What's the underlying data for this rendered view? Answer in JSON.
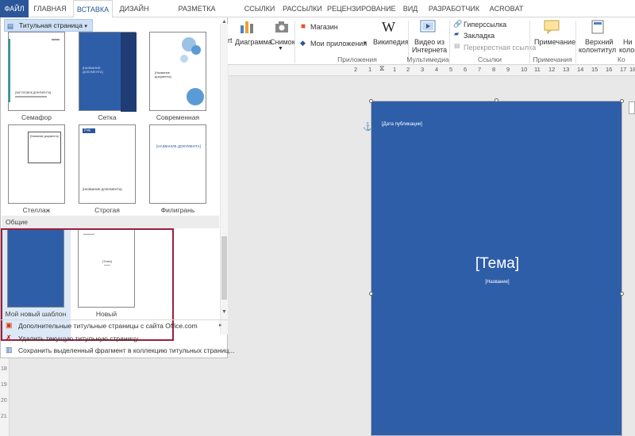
{
  "tabs": [
    "ФАЙЛ",
    "ГЛАВНАЯ",
    "ВСТАВКА",
    "ДИЗАЙН",
    "РАЗМЕТКА СТРАНИЦЫ",
    "ССЫЛКИ",
    "РАССЫЛКИ",
    "РЕЦЕНЗИРОВАНИЕ",
    "ВИД",
    "РАЗРАБОТЧИК",
    "ACROBAT"
  ],
  "ribbon": {
    "partial_left": "rt",
    "diagram": "Диаграмма",
    "snapshot": "Снимок",
    "store": "Магазин",
    "my_apps": "Мои приложения",
    "wikipedia": "Википедия",
    "video_line1": "Видео из",
    "video_line2": "Интернета",
    "hyperlink": "Гиперссылка",
    "bookmark": "Закладка",
    "crossref": "Перекрестная ссылка",
    "comment": "Примечание",
    "header_line1": "Верхний",
    "header_line2": "колонтитул",
    "footer_line1": "Ни",
    "footer_line2": "колон",
    "groups": {
      "apps": "Приложения",
      "media": "Мультимедиа",
      "links": "Ссылки",
      "comments": "Примечания",
      "header": "Ко"
    }
  },
  "gallery": {
    "button": "Титульная страница",
    "builtin": [
      {
        "label": "Семафор"
      },
      {
        "label": "Сетка"
      },
      {
        "label": "Современная"
      },
      {
        "label": "Стеллаж"
      },
      {
        "label": "Строгая"
      },
      {
        "label": "Филигрань"
      }
    ],
    "section_custom": "Общие",
    "custom": [
      {
        "label": "Мой новый шаблон"
      },
      {
        "label": "Новый"
      }
    ],
    "thumb_text": {
      "semafor": "[ЗАГОЛОВОК ДОКУМЕНТА]",
      "setka": "[НАЗВАНИЕ ДОКУМЕНТА]",
      "sovremennaya": "[Название документа]",
      "stellazh": "[Название документа]",
      "strogaya_year": "[Год]",
      "strogaya_title": "[НАЗВАНИЕ ДОКУМЕНТА]",
      "filigran": "[НАЗВАНИЕ ДОКУМЕНТА]",
      "noviy": "[Тема]"
    },
    "menu": [
      "Дополнительные титульные страницы с сайта Office.com",
      "Удалить текущую титульную страницу",
      "Сохранить выделенный фрагмент в коллекцию титульных страниц..."
    ]
  },
  "ruler": [
    "2",
    "1",
    "1",
    "2",
    "3",
    "4",
    "5",
    "6",
    "7",
    "8",
    "9",
    "10",
    "11",
    "12",
    "13",
    "14",
    "15",
    "16",
    "17",
    "18"
  ],
  "vruler": [
    "18",
    "19",
    "20",
    "21"
  ],
  "document": {
    "date": "[Дата публикации]",
    "title": "[Тема]",
    "subtitle": "[Название]"
  },
  "colors": {
    "accent": "#2b579a",
    "cover_blue": "#2f5ea9",
    "highlight_frame": "#9c1f3e"
  }
}
